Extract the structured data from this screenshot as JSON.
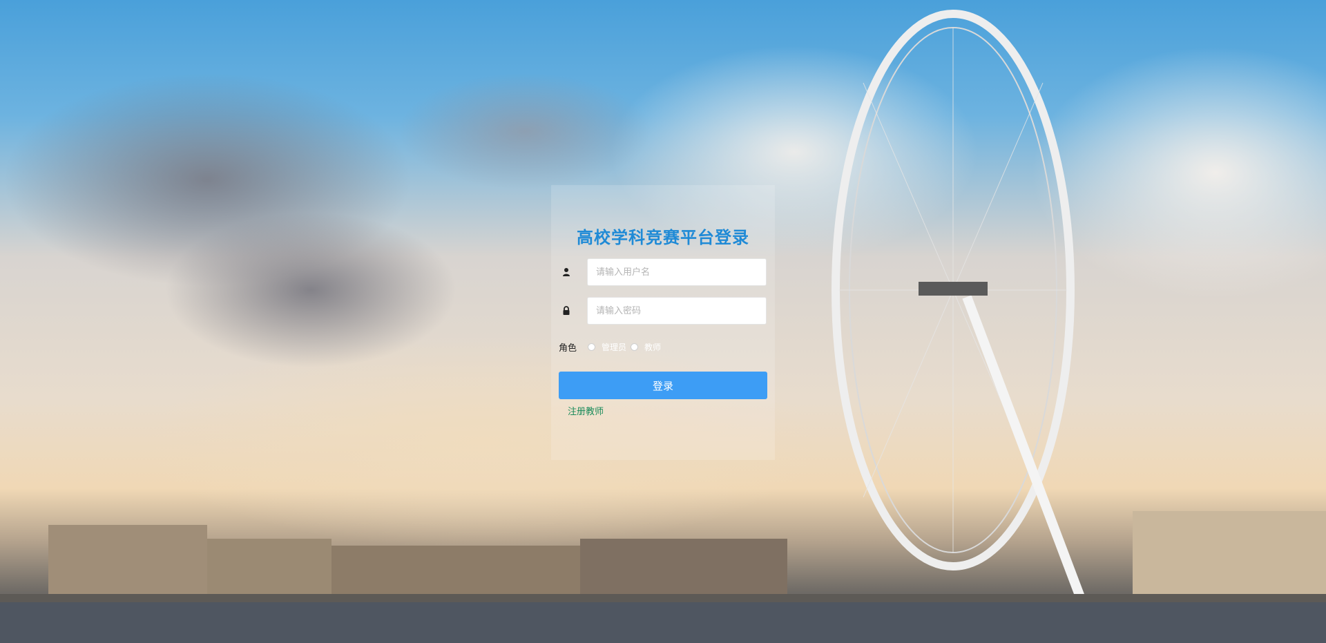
{
  "login": {
    "title": "高校学科竞赛平台登录",
    "username_placeholder": "请输入用户名",
    "password_placeholder": "请输入密码",
    "role_label": "角色",
    "role_options": [
      "管理员",
      "教师"
    ],
    "login_button": "登录",
    "register_link": "注册教师"
  },
  "icons": {
    "username": "user-icon",
    "password": "lock-icon"
  },
  "colors": {
    "title": "#1f8ad6",
    "button": "#3d9df5",
    "link": "#1a8b5a"
  }
}
